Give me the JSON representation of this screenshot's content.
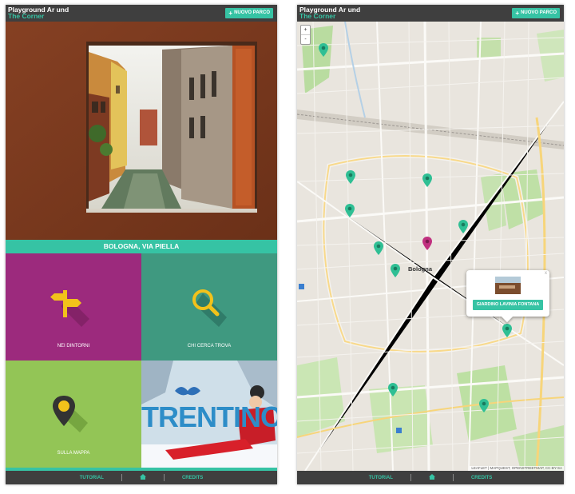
{
  "app": {
    "logo_line1": "Playground Ar und",
    "logo_line2": "The Corner",
    "new_park_label": "NUOVO PARCO"
  },
  "home_screen": {
    "caption": "BOLOGNA, VIA PIELLA",
    "tiles": [
      {
        "label": "NEI DINTORNI",
        "icon": "signpost-icon",
        "color": "#9c2a7d"
      },
      {
        "label": "CHI CERCA TROVA",
        "icon": "magnifier-icon",
        "color": "#3f9980"
      },
      {
        "label": "SULLA MAPPA",
        "icon": "map-pin-icon",
        "color": "#93c556"
      }
    ],
    "ad_text": "TRENTINO"
  },
  "map_screen": {
    "zoom_in": "+",
    "zoom_out": "-",
    "city_label": "Bologna",
    "popup_button": "GIARDINO LAVINIA FONTANA",
    "popup_close": "x",
    "attribution": "LEAFLET | MAPQUEST, OPENSTREETMAP, CC-BY-SA"
  },
  "bottom_nav": {
    "tutorial": "TUTORIAL",
    "home_icon": "home-icon",
    "credits": "CREDITS"
  },
  "colors": {
    "accent": "#36c3a4",
    "bar": "#3f3f3f",
    "pin_green": "#36c3a4",
    "pin_selected": "#c0307f"
  }
}
